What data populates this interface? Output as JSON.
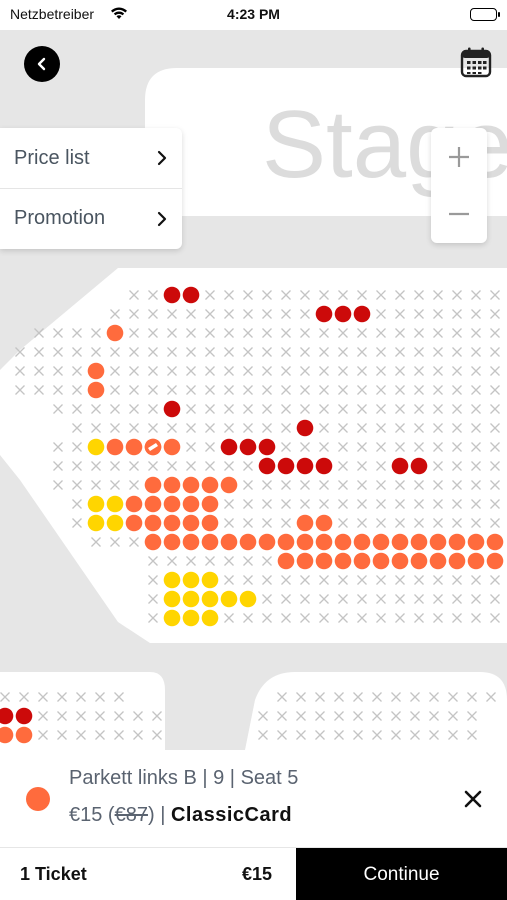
{
  "status_bar": {
    "carrier": "Netzbetreiber",
    "time": "4:23 PM"
  },
  "stage": {
    "label": "Stage"
  },
  "menu": {
    "items": [
      {
        "label": "Price list"
      },
      {
        "label": "Promotion"
      }
    ]
  },
  "colors": {
    "background": "#e6e6e6",
    "section": "#ffffff",
    "seat_unavailable": "#c4c4c4",
    "price_dark_red": "#cc0a0a",
    "price_orange": "#ff6b3d",
    "price_yellow": "#ffd500",
    "accent_black": "#000000"
  },
  "seatmap": {
    "legend_note": "Available seat dots are colored by price category; unavailable seats shown as crosses",
    "notable_seats": [
      {
        "row": 9,
        "seat": 5,
        "status": "selected",
        "category_color": "#ff6b3d"
      }
    ]
  },
  "selection": {
    "title": "Parkett links B | 9 | Seat 5",
    "price": "€15",
    "price_open": " (",
    "original_price": "€87",
    "price_close": ")",
    "separator": " | ",
    "card": "ClassicCard"
  },
  "footer": {
    "ticket_count": "1 Ticket",
    "total": "€15",
    "continue_label": "Continue"
  }
}
